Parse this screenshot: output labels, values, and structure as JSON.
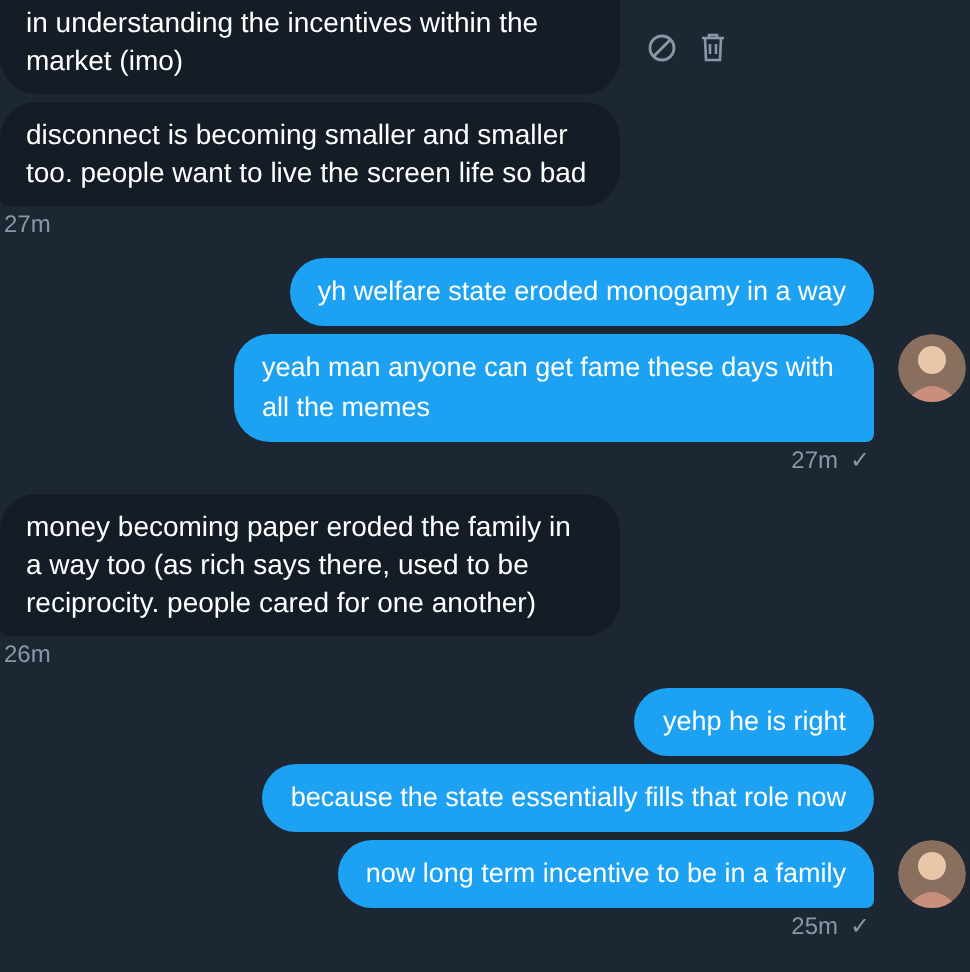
{
  "conversation": [
    {
      "kind": "received",
      "messages": [
        {
          "text": "in understanding the incentives within the market (imo)",
          "hover_actions": true
        },
        {
          "text": "disconnect is becoming smaller and smaller too. people want to live the screen life so bad",
          "hover_actions": false
        }
      ],
      "time": "27m"
    },
    {
      "kind": "sent",
      "messages": [
        {
          "text": "yh welfare state eroded monogamy in a way"
        },
        {
          "text": "yeah man anyone can get fame these days with all the memes"
        }
      ],
      "time": "27m",
      "receipt": "✓"
    },
    {
      "kind": "received",
      "messages": [
        {
          "text": "money becoming paper eroded the family in a way too (as rich says there, used to be reciprocity. people cared for one another)",
          "hover_actions": false
        }
      ],
      "time": "26m"
    },
    {
      "kind": "sent",
      "messages": [
        {
          "text": "yehp he is right"
        },
        {
          "text": "because the state essentially fills that role now"
        },
        {
          "text": "now long term incentive to be in a family"
        }
      ],
      "time": "25m",
      "receipt": "✓"
    }
  ]
}
